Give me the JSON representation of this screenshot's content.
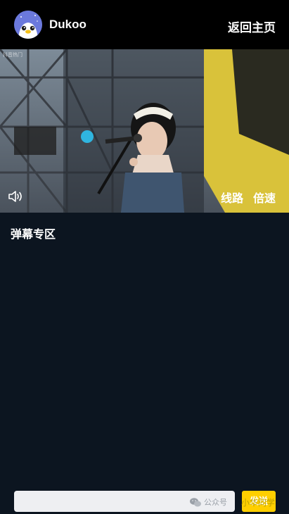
{
  "header": {
    "app_name": "Dukoo",
    "home_button": "返回主页"
  },
  "video": {
    "corner_watermark": "抖音热门",
    "route_button": "线路",
    "speed_button": "倍速",
    "volume_icon": "speaker-icon"
  },
  "danmaku": {
    "title": "弹幕专区"
  },
  "input_bar": {
    "input_value": "",
    "watermark": "公众号",
    "send_button": "发送",
    "send_overlay": "小华同学"
  },
  "colors": {
    "background": "#0c1520",
    "topbar": "#000000",
    "send_button": "#ffcf00"
  }
}
